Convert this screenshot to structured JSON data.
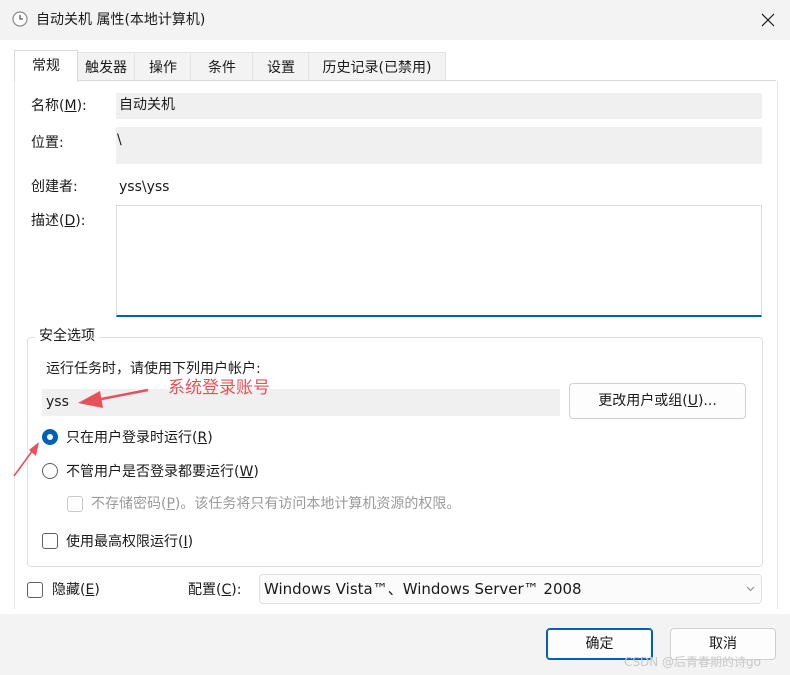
{
  "window": {
    "title": "自动关机 属性(本地计算机)"
  },
  "tabs": [
    {
      "label": "常规",
      "active": true
    },
    {
      "label": "触发器",
      "active": false
    },
    {
      "label": "操作",
      "active": false
    },
    {
      "label": "条件",
      "active": false
    },
    {
      "label": "设置",
      "active": false
    },
    {
      "label": "历史记录(已禁用)",
      "active": false
    }
  ],
  "general": {
    "name_label_pre": "名称(",
    "name_label_key": "M",
    "name_label_post": "):",
    "name_value": "自动关机",
    "location_label": "位置:",
    "location_value": "\\",
    "author_label": "创建者:",
    "author_value": "yss\\yss",
    "desc_label_pre": "描述(",
    "desc_label_key": "D",
    "desc_label_post": "):",
    "desc_value": ""
  },
  "security": {
    "group_title": "安全选项",
    "run_as_text": "运行任务时，请使用下列用户帐户:",
    "user_value": "yss",
    "change_user_pre": "更改用户或组(",
    "change_user_key": "U",
    "change_user_post": ")...",
    "radio_logged_pre": "只在用户登录时运行(",
    "radio_logged_key": "R",
    "radio_logged_post": ")",
    "radio_any_pre": "不管用户是否登录都要运行(",
    "radio_any_key": "W",
    "radio_any_post": ")",
    "no_store_pre": "不存储密码(",
    "no_store_key": "P",
    "no_store_post": ")。该任务将只有访问本地计算机资源的权限。",
    "highest_pre": "使用最高权限运行(",
    "highest_key": "I",
    "highest_post": ")",
    "selected_radio": "logged_on_only"
  },
  "footer": {
    "hidden_pre": "隐藏(",
    "hidden_key": "E",
    "hidden_post": ")",
    "config_pre": "配置(",
    "config_key": "C",
    "config_post": "):",
    "config_value": "Windows Vista™、Windows Server™ 2008",
    "ok_label": "确定",
    "cancel_label": "取消"
  },
  "annotation": {
    "text": "系统登录账号"
  },
  "watermark": "CSDN @后青春期的诗go",
  "colors": {
    "accent": "#005fb8",
    "annotation": "#e8505b"
  }
}
